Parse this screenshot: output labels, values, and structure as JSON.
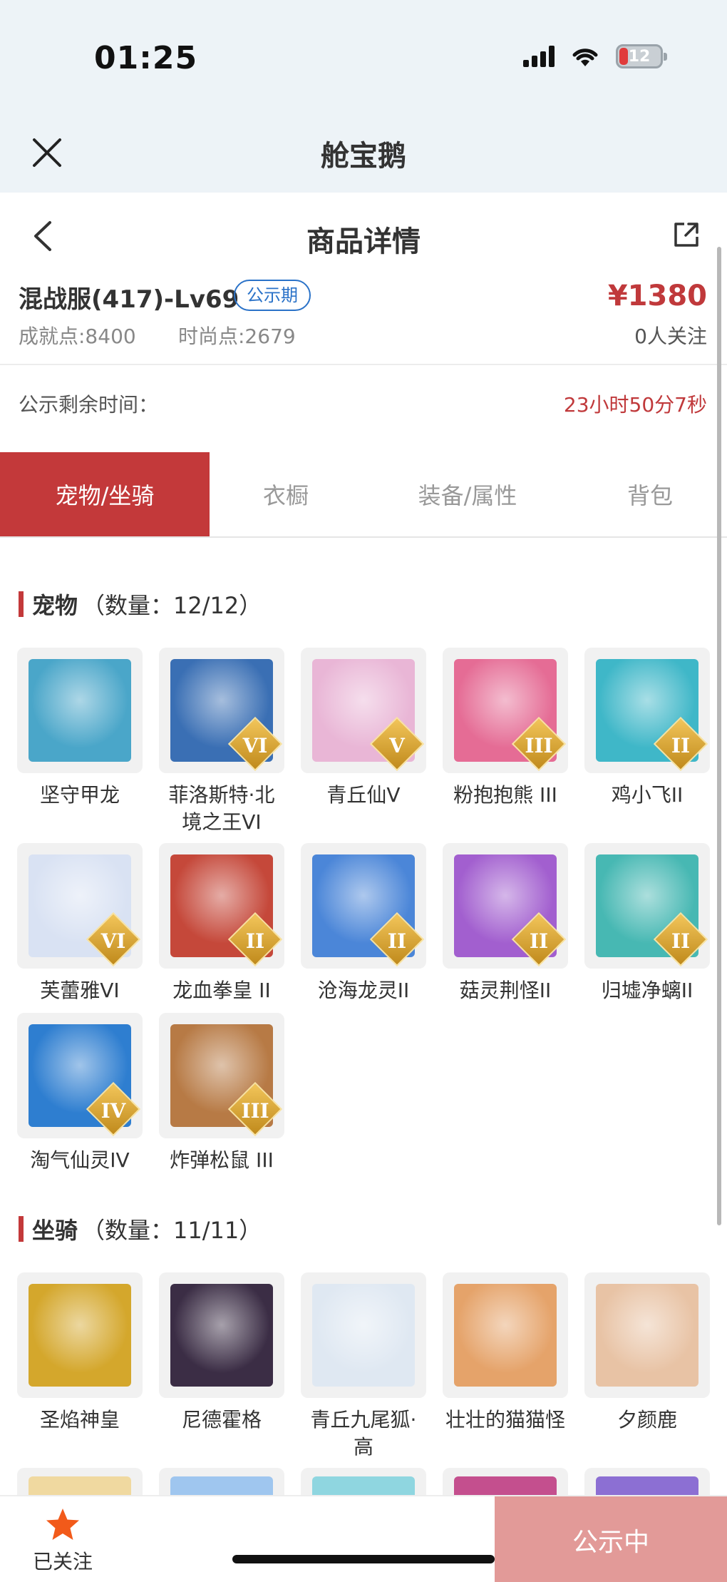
{
  "status": {
    "time": "01:25",
    "battery": "12"
  },
  "app": {
    "title": "舱宝鹅",
    "close_icon": "close-icon"
  },
  "nav": {
    "title": "商品详情",
    "back_icon": "chevron-left-icon",
    "share_icon": "share-icon"
  },
  "product": {
    "server": "混战服(417)-Lv69",
    "badge": "公示期",
    "price": "¥1380",
    "achievement": "成就点:8400",
    "fashion": "时尚点:2679",
    "followers": "0人关注",
    "remaining_label": "公示剩余时间：",
    "remaining_value": "23小时50分7秒"
  },
  "tabs": [
    {
      "label": "宠物/坐骑",
      "active": true
    },
    {
      "label": "衣橱",
      "active": false
    },
    {
      "label": "装备/属性",
      "active": false
    },
    {
      "label": "背包",
      "active": false
    }
  ],
  "pets": {
    "title": "宠物",
    "count": "（数量：12/12）",
    "items": [
      {
        "name": "坚守甲龙",
        "tier": "",
        "color": "#4aa6c9"
      },
      {
        "name": "菲洛斯特·北境之王VI",
        "tier": "VI",
        "color": "#3a6fb4"
      },
      {
        "name": "青丘仙V",
        "tier": "V",
        "color": "#e9b6d6"
      },
      {
        "name": "粉抱抱熊 III",
        "tier": "III",
        "color": "#e56c95"
      },
      {
        "name": "鸡小飞II",
        "tier": "II",
        "color": "#3fb7c8"
      },
      {
        "name": "芙蕾雅VI",
        "tier": "VI",
        "color": "#d9e2f3"
      },
      {
        "name": "龙血拳皇 II",
        "tier": "II",
        "color": "#c5483a"
      },
      {
        "name": "沧海龙灵II",
        "tier": "II",
        "color": "#4b86d8"
      },
      {
        "name": "菇灵荆怪II",
        "tier": "II",
        "color": "#a25fcf"
      },
      {
        "name": "归墟净螭II",
        "tier": "II",
        "color": "#47b8b3"
      },
      {
        "name": "淘气仙灵IV",
        "tier": "IV",
        "color": "#2e7ed0"
      },
      {
        "name": "炸弹松鼠 III",
        "tier": "III",
        "color": "#b77a45"
      }
    ]
  },
  "mounts": {
    "title": "坐骑",
    "count": "（数量：11/11）",
    "items": [
      {
        "name": "圣焰神皇",
        "tier": "",
        "color": "#d4a72c"
      },
      {
        "name": "尼德霍格",
        "tier": "",
        "color": "#3b2d45"
      },
      {
        "name": "青丘九尾狐·高",
        "tier": "",
        "color": "#dfe8f2"
      },
      {
        "name": "壮壮的猫猫怪",
        "tier": "",
        "color": "#e5a36a"
      },
      {
        "name": "夕颜鹿",
        "tier": "",
        "color": "#e8c3a5"
      }
    ]
  },
  "bottom": {
    "followed_label": "已关注",
    "action_label": "公示中",
    "star_color": "#f25a1a"
  }
}
